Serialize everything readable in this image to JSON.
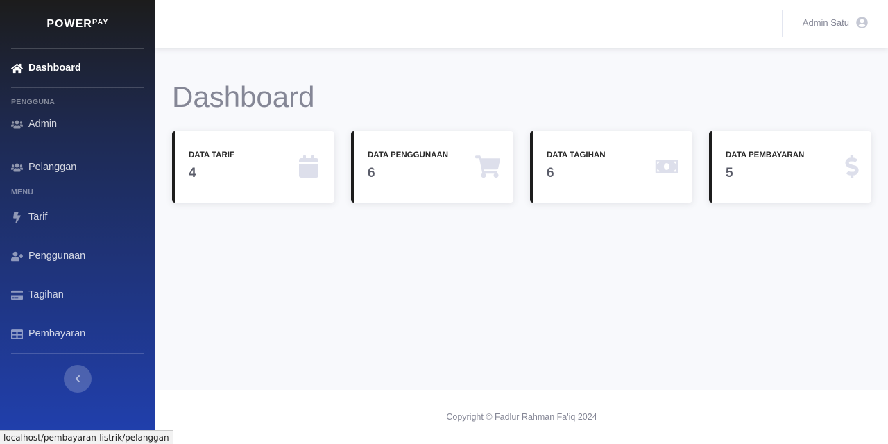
{
  "brand": {
    "name": "POWER",
    "sup": "PAY"
  },
  "sidebar": {
    "dashboard": "Dashboard",
    "heading_users": "PENGGUNA",
    "admin": "Admin",
    "pelanggan": "Pelanggan",
    "heading_menu": "MENU",
    "tarif": "Tarif",
    "penggunaan": "Penggunaan",
    "tagihan": "Tagihan",
    "pembayaran": "Pembayaran"
  },
  "topbar": {
    "user_name": "Admin Satu"
  },
  "page": {
    "title": "Dashboard"
  },
  "cards": [
    {
      "label": "DATA TARIF",
      "value": "4",
      "icon": "calendar-icon"
    },
    {
      "label": "DATA PENGGUNAAN",
      "value": "6",
      "icon": "cart-icon"
    },
    {
      "label": "DATA TAGIHAN",
      "value": "6",
      "icon": "money-bill-icon"
    },
    {
      "label": "DATA PEMBAYARAN",
      "value": "5",
      "icon": "dollar-icon"
    }
  ],
  "footer": {
    "copyright": "Copyright © Fadlur Rahman Fa'iq 2024"
  },
  "status_url": "localhost/pembayaran-listrik/pelanggan",
  "colors": {
    "card_border": "#1c1c1c",
    "sidebar_bottom": "#2040b0",
    "page_bg": "#f8f9fc"
  }
}
